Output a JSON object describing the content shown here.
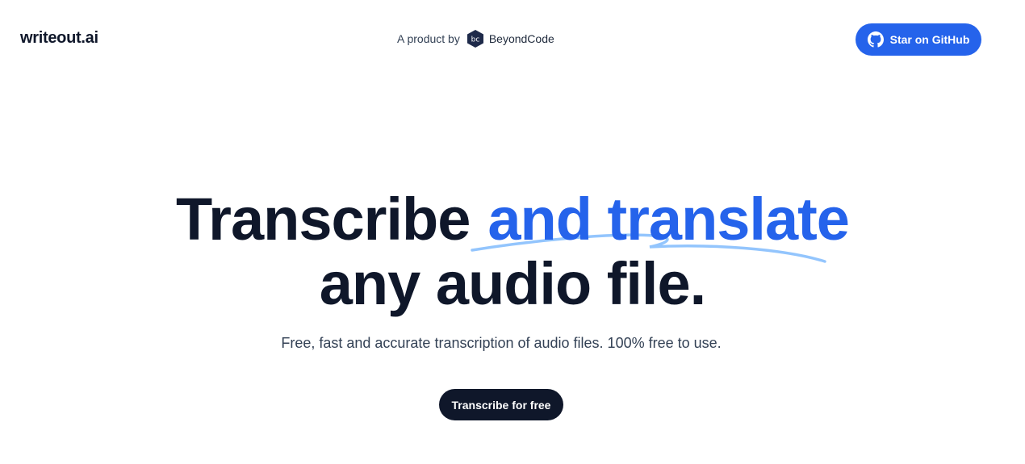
{
  "header": {
    "logo_text": "writeout.ai",
    "product_by_label": "A product by",
    "brand_name": "BeyondCode",
    "brand_badge_text": "bc",
    "github_button_label": "Star on GitHub"
  },
  "hero": {
    "title_part1": "Transcribe",
    "title_accent": "and translate",
    "title_line2": "any audio file.",
    "subtitle": "Free, fast and accurate transcription of audio files. 100% free to use.",
    "cta_label": "Transcribe for free"
  },
  "colors": {
    "accent": "#2563eb",
    "dark": "#0f172a",
    "badge": "#1e2a4a",
    "swash": "#93c5fd"
  },
  "icons": {
    "github": "github-icon",
    "brand": "beyondcode-logo-icon",
    "swash": "underline-swash-decoration"
  }
}
